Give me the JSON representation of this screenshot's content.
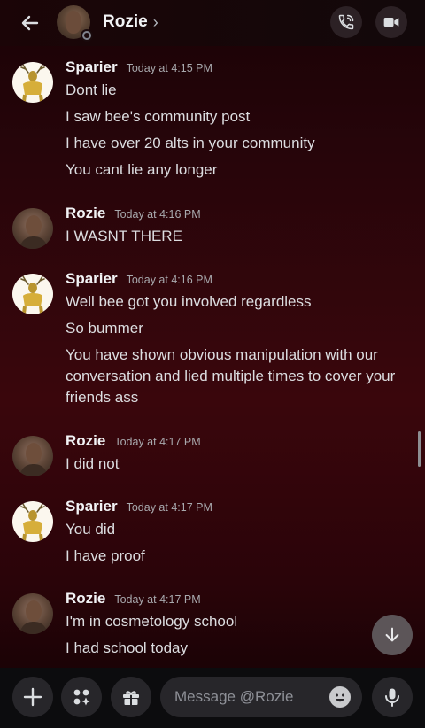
{
  "header": {
    "title": "Rozie",
    "chevron": "›",
    "back_icon": "arrow-left-icon",
    "call_icon": "phone-call-icon",
    "video_icon": "video-camera-icon",
    "status": "offline"
  },
  "messages": [
    {
      "author": "Sparier",
      "time": "Today at 4:15 PM",
      "lines": [
        "Dont lie",
        "I saw bee's community post",
        "I have over 20 alts in your community",
        "You cant lie any longer"
      ]
    },
    {
      "author": "Rozie",
      "time": "Today at 4:16 PM",
      "lines": [
        "I WASNT THERE"
      ]
    },
    {
      "author": "Sparier",
      "time": "Today at 4:16 PM",
      "lines": [
        "Well bee got you involved regardless",
        "So bummer",
        "You have shown obvious manipulation with our",
        "conversation and lied multiple times to cover your",
        "friends ass"
      ]
    },
    {
      "author": "Rozie",
      "time": "Today at 4:17 PM",
      "lines": [
        "I did not"
      ]
    },
    {
      "author": "Sparier",
      "time": "Today at 4:17 PM",
      "lines": [
        "You did",
        "I have proof"
      ]
    },
    {
      "author": "Rozie",
      "time": "Today at 4:17 PM",
      "lines": [
        "I'm in cosmetology school",
        "I had school today"
      ]
    }
  ],
  "composer": {
    "placeholder": "Message @Rozie",
    "plus_icon": "plus-icon",
    "apps_icon": "apps-icon",
    "gift_icon": "gift-icon",
    "emoji_icon": "emoji-icon",
    "mic_icon": "microphone-icon"
  },
  "jump_icon": "arrow-down-icon",
  "colors": {
    "background_top": "#1a0205",
    "background_mid": "#3a060c",
    "composer_bg": "#0c0c0e",
    "button_bg": "#27262a"
  }
}
